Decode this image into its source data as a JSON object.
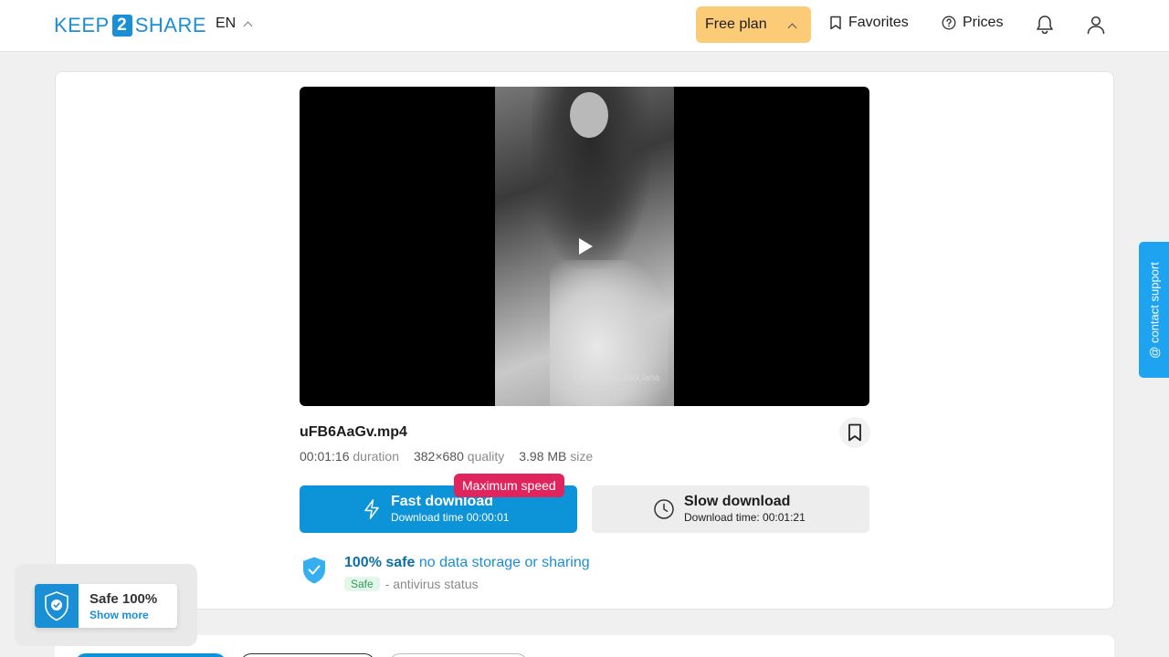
{
  "header": {
    "logo_left": "KEEP",
    "logo_mid": "2",
    "logo_right": "SHARE",
    "lang": "EN",
    "plan_label": "Free plan",
    "favorites_label": "Favorites",
    "prices_label": "Prices"
  },
  "file": {
    "name": "uFB6AaGv.mp4",
    "duration_value": "00:01:16",
    "duration_label": "duration",
    "quality_value": "382×680",
    "quality_label": "quality",
    "size_value": "3.98 MB",
    "size_label": "size",
    "watermark": "OnlyFans.com/x.lana"
  },
  "download": {
    "badge": "Maximum speed",
    "fast_title": "Fast download",
    "fast_sub": "Download time 00:00:01",
    "slow_title": "Slow download",
    "slow_sub": "Download time: 00:01:21"
  },
  "safety": {
    "title_bold": "100% safe",
    "title_rest": "no data storage or sharing",
    "pill": "Safe",
    "status": "- antivirus status"
  },
  "popup": {
    "title": "Safe 100%",
    "link": "Show more"
  },
  "contact": {
    "label": "@ contact support"
  },
  "colors": {
    "brand": "#1a8fd6",
    "plan": "#fccb78",
    "fast_button": "#0c93d8",
    "badge": "#e0245e"
  }
}
